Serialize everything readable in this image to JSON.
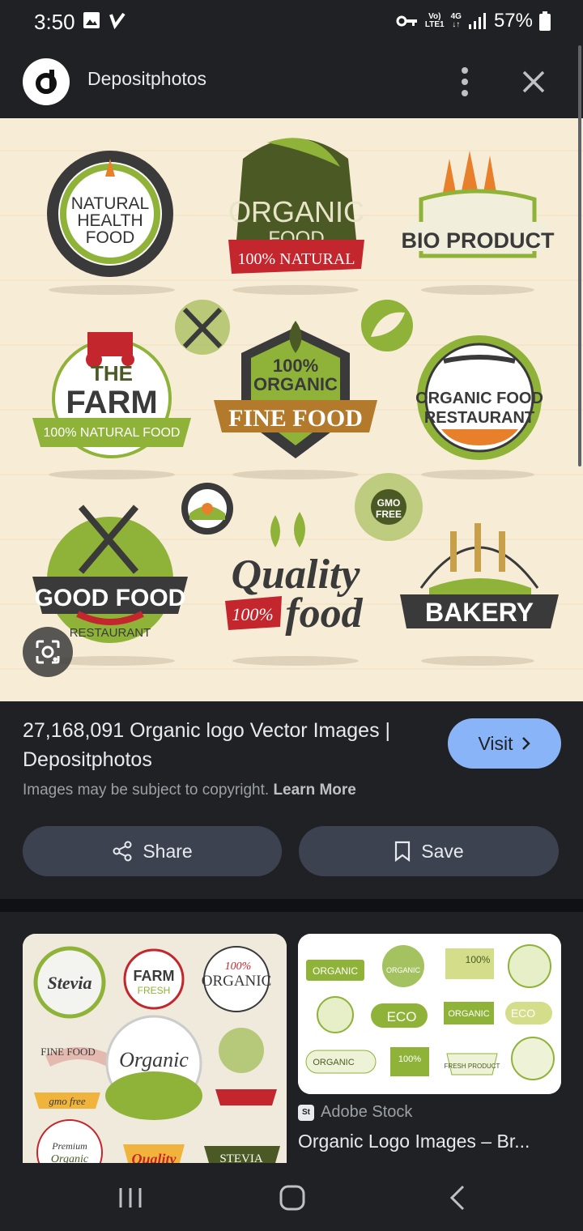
{
  "status_bar": {
    "time": "3:50",
    "network_top": "Vo)",
    "network_bottom": "LTE1",
    "data_type_top": "4G",
    "data_type_bottom": "↓↑",
    "battery": "57%"
  },
  "header": {
    "site_name": "Depositphotos"
  },
  "hero_image": {
    "badges": {
      "natural_health": [
        "NATURAL",
        "HEALTH",
        "FOOD"
      ],
      "organic_food": [
        "ORGANIC",
        "FOOD",
        "100% NATURAL"
      ],
      "bio_product": "BIO PRODUCT",
      "the_farm": [
        "THE",
        "FARM",
        "100% NATURAL FOOD"
      ],
      "fine_food": [
        "100%",
        "ORGANIC",
        "FINE FOOD"
      ],
      "organic_restaurant": [
        "ORGANIC FOOD",
        "RESTAURANT"
      ],
      "gmo_free": [
        "GMO",
        "FREE"
      ],
      "good_food": [
        "GOOD FOOD",
        "RESTAURANT"
      ],
      "quality_food": [
        "Quality",
        "100%",
        "food"
      ],
      "bakery": "BAKERY"
    }
  },
  "result": {
    "title": "27,168,091 Organic logo Vector Images | Depositphotos",
    "visit_label": "Visit",
    "copyright_text": "Images may be subject to copyright.",
    "learn_more": "Learn More",
    "share_label": "Share",
    "save_label": "Save"
  },
  "related": {
    "left_thumb_labels": {
      "stevia": "Stevia",
      "farm": "FARM",
      "farm_sub": "FRESH",
      "organic_pct": "100%",
      "organic": "ORGANIC",
      "fine_food": "FINE FOOD",
      "organic_script": "Organic",
      "gmo_free": "gmo free",
      "premium": "Premium",
      "organic_food2": "Organic",
      "quality": "Quality",
      "stevia2": "STEVIA"
    },
    "right_thumb_labels": {
      "organic1": "ORGANIC",
      "organic2": "ORGANIC",
      "pct100": "100%",
      "eco1": "ECO",
      "organic3": "ORGANIC",
      "eco2": "ECO",
      "organic4": "ORGANIC",
      "pct100b": "100%",
      "fresh": "FRESH PRODUCT"
    },
    "source": "Adobe Stock",
    "source_favicon": "St",
    "title": "Organic Logo Images – Br..."
  },
  "colors": {
    "dark_bg": "#202124",
    "accent_blue": "#8ab4f8",
    "button_bg": "#3c4250",
    "olive_green": "#8fb339",
    "dark_olive": "#3f4a1c",
    "red": "#c4262e",
    "cream": "#f7ecd6"
  }
}
